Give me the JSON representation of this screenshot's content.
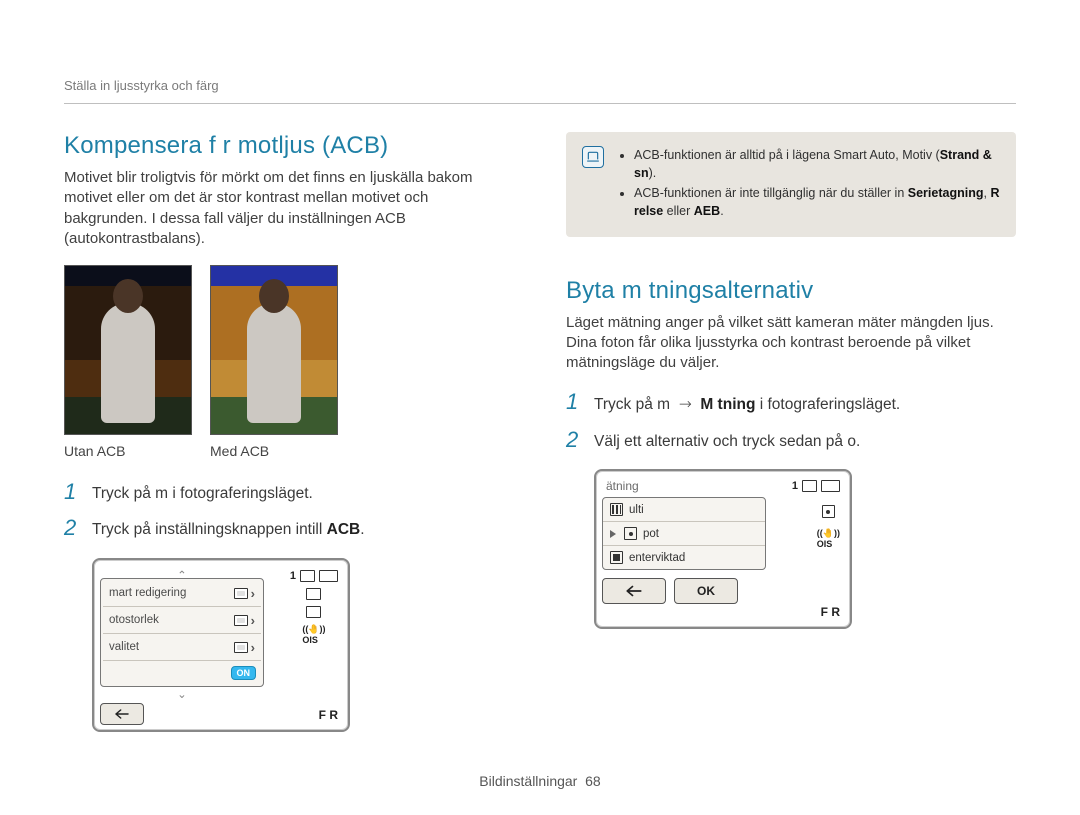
{
  "breadcrumb": "Ställa in ljusstyrka och färg",
  "left": {
    "heading": "Kompensera f r motljus (ACB)",
    "intro": "Motivet blir troligtvis för mörkt om det finns en ljuskälla bakom motivet eller om det är stor kontrast mellan motivet och bakgrunden. I dessa fall väljer du inställningen ACB (autokontrastbalans).",
    "caption_off": "Utan ACB",
    "caption_on": "Med ACB",
    "step1_pre": "Tryck på ",
    "step1_m": "m",
    "step1_post": " i fotograferingsläget.",
    "step2_pre": "Tryck på inställningsknappen intill ",
    "step2_bold": "ACB",
    "step2_post": ".",
    "screen": {
      "rows": [
        {
          "label": "mart redigering"
        },
        {
          "label": "otostorlek"
        },
        {
          "label": "valitet"
        }
      ],
      "on_badge": "ON",
      "right_status_1": "1",
      "flash_label": "F R"
    }
  },
  "right": {
    "note": {
      "line1_pre": "ACB-funktionen är alltid på i lägena Smart Auto, Motiv (",
      "line1_bold": "Strand & sn",
      "line1_post": ").",
      "line2_pre": "ACB-funktionen är inte tillgänglig när du ställer in ",
      "line2_b1": "Serietagning",
      "line2_mid": ", ",
      "line2_b2": "R relse",
      "line2_mid2": " eller ",
      "line2_b3": "AEB",
      "line2_post": "."
    },
    "heading": "Byta m tningsalternativ",
    "intro": "Läget mätning anger på vilket sätt kameran mäter mängden ljus. Dina foton får olika ljusstyrka och kontrast beroende på vilket mätningsläge du väljer.",
    "step1_pre": "Tryck på ",
    "step1_m": "m",
    "step1_arrow": "→",
    "step1_bold": "M tning",
    "step1_post": " i fotograferingsläget.",
    "step2_pre": "Välj ett alternativ och tryck sedan på ",
    "step2_o": "o",
    "step2_post": ".",
    "screen": {
      "title": "ätning",
      "right_status_1": "1",
      "options": [
        {
          "label": "ulti"
        },
        {
          "label": "pot"
        },
        {
          "label": "enterviktad"
        }
      ],
      "ok_label": "OK",
      "flash_label": "F R"
    }
  },
  "footer_label": "Bildinställningar",
  "footer_page": "68"
}
